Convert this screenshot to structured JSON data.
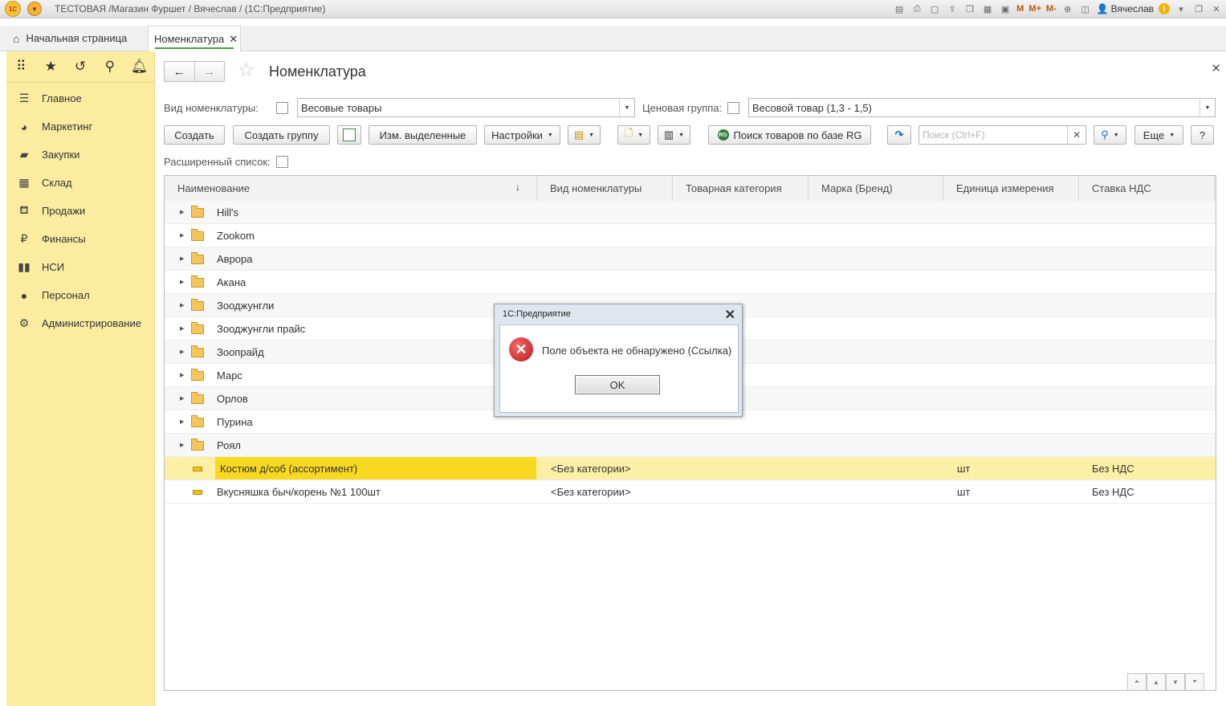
{
  "window": {
    "title": "ТЕСТОВАЯ /Магазин Фуршет / Вячеслав / (1С:Предприятие)",
    "logo_text": "1С",
    "user": "Вячеслав",
    "memory_buttons": [
      "M",
      "M+",
      "M-"
    ]
  },
  "tabs": {
    "home": "Начальная страница",
    "active": "Номенклатура"
  },
  "sidebar": {
    "items": [
      {
        "label": "Главное",
        "icon": "list-icon"
      },
      {
        "label": "Маркетинг",
        "icon": "pie-chart-icon"
      },
      {
        "label": "Закупки",
        "icon": "truck-icon"
      },
      {
        "label": "Склад",
        "icon": "warehouse-icon"
      },
      {
        "label": "Продажи",
        "icon": "basket-icon"
      },
      {
        "label": "Финансы",
        "icon": "ruble-icon"
      },
      {
        "label": "НСИ",
        "icon": "books-icon"
      },
      {
        "label": "Персонал",
        "icon": "person-icon"
      },
      {
        "label": "Администрирование",
        "icon": "gear-icon"
      }
    ]
  },
  "page": {
    "title": "Номенклатура"
  },
  "filters": {
    "kind_label": "Вид номенклатуры:",
    "kind_value": "Весовые товары",
    "price_group_label": "Ценовая группа:",
    "price_group_value": "Весовой товар (1,3 - 1,5)",
    "extended_list_label": "Расширенный список:"
  },
  "toolbar": {
    "create": "Создать",
    "create_group": "Создать группу",
    "edit_selected": "Изм. выделенные",
    "settings": "Настройки",
    "rg_search": "Поиск товаров по базе RG",
    "search_placeholder": "Поиск (Ctrl+F)",
    "more": "Еще",
    "help": "?"
  },
  "table": {
    "columns": [
      "Наименование",
      "Вид номенклатуры",
      "Товарная категория",
      "Марка (Бренд)",
      "Единица измерения",
      "Ставка НДС"
    ],
    "groups": [
      "Hill's",
      "Zookom",
      "Аврора",
      "Акана",
      "Зооджунгли",
      "Зооджунгли прайс",
      "Зоопрайд",
      "Марс",
      "Орлов",
      "Пурина",
      "Роял"
    ],
    "items": [
      {
        "name": "Костюм д/соб (ассортимент)",
        "kind": "<Без категории>",
        "category": "",
        "brand": "",
        "unit": "шт",
        "vat": "Без НДС"
      },
      {
        "name": "Вкусняшка быч/корень №1 100шт",
        "kind": "<Без категории>",
        "category": "",
        "brand": "",
        "unit": "шт",
        "vat": "Без НДС"
      }
    ]
  },
  "dialog": {
    "title": "1С:Предприятие",
    "message": "Поле объекта не обнаружено (Ссылка)",
    "ok": "OK"
  }
}
